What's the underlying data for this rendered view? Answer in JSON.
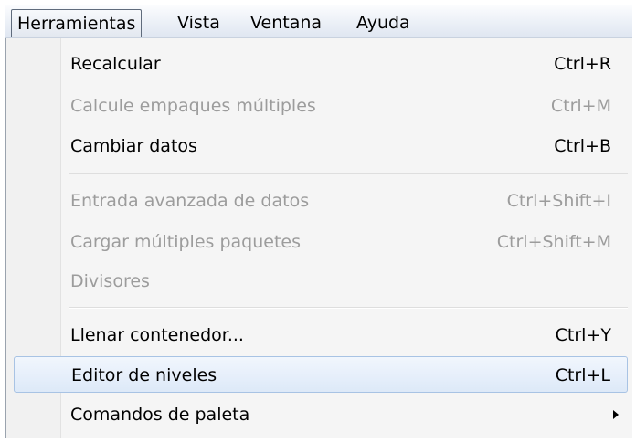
{
  "menubar": {
    "items": [
      {
        "label": "Herramientas"
      },
      {
        "label": "Vista"
      },
      {
        "label": "Ventana"
      },
      {
        "label": "Ayuda"
      }
    ]
  },
  "menu": {
    "items": [
      {
        "label": "Recalcular",
        "shortcut": "Ctrl+R",
        "enabled": true
      },
      {
        "label": "Calcule empaques múltiples",
        "shortcut": "Ctrl+M",
        "enabled": false
      },
      {
        "label": "Cambiar datos",
        "shortcut": "Ctrl+B",
        "enabled": true
      },
      {
        "label": "Entrada avanzada de datos",
        "shortcut": "Ctrl+Shift+I",
        "enabled": false
      },
      {
        "label": "Cargar múltiples paquetes",
        "shortcut": "Ctrl+Shift+M",
        "enabled": false
      },
      {
        "label": "Divisores",
        "shortcut": "",
        "enabled": false
      },
      {
        "label": "Llenar contenedor...",
        "shortcut": "Ctrl+Y",
        "enabled": true
      },
      {
        "label": "Editor de niveles",
        "shortcut": "Ctrl+L",
        "enabled": true,
        "highlighted": true
      },
      {
        "label": "Comandos de paleta",
        "shortcut": "",
        "enabled": true,
        "submenu": true
      }
    ]
  }
}
